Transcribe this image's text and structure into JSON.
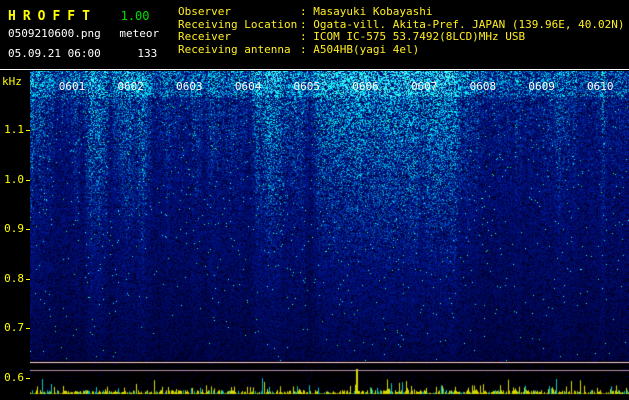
{
  "header": {
    "app_name": "HROFFT",
    "version": "1.00",
    "file_name": "0509210600.png",
    "mode": "meteor",
    "datetime": "05.09.21 06:00",
    "count": "133",
    "info": [
      {
        "label": "Observer",
        "value": ": Masayuki Kobayashi"
      },
      {
        "label": "Receiving Location",
        "value": ": Ogata-vill. Akita-Pref. JAPAN (139.96E, 40.02N)"
      },
      {
        "label": "Receiver",
        "value": ": ICOM IC-575 53.7492(8LCD)MHz USB"
      },
      {
        "label": "Receiving antenna",
        "value": ": A504HB(yagi 4el)"
      }
    ]
  },
  "chart_data": {
    "type": "heatmap",
    "title": "HROFFT 1.00 radio meteor echo spectrogram, 05.09.21 06:00",
    "x_tick_labels": [
      "0601",
      "0602",
      "0603",
      "0604",
      "0605",
      "0606",
      "0607",
      "0608",
      "0609",
      "0610"
    ],
    "ylabel": "kHz",
    "y_tick_labels": [
      "1.1",
      "1.0",
      "0.9",
      "0.8",
      "0.7",
      "0.6"
    ],
    "y_range_khz": [
      0.55,
      1.18
    ],
    "x_range_time": [
      "0600",
      "0610"
    ],
    "features": {
      "echo_count_shown": 133,
      "carrier_line_khz": 0.63,
      "noise_floor": "blue noise spectrogram, brightest above 1.0 kHz, fading to black below 0.7 kHz",
      "signal_level_trace": "yellow/cyan level bars along bottom of plot",
      "largest_signal_spike_time": "0606"
    }
  },
  "colors": {
    "title_yellow": "#ffff00",
    "version_green": "#00dd00",
    "text_white": "#ffffff",
    "info_yellow": "#ffee22",
    "axis_yellow": "#ffff00",
    "carrier_line": "#ffd0dd",
    "carrier_line_dim": "#b090a8",
    "bar_yellow": "#d8d800",
    "bar_cyan": "#00c8c8",
    "baseline_yellow": "#606000"
  }
}
